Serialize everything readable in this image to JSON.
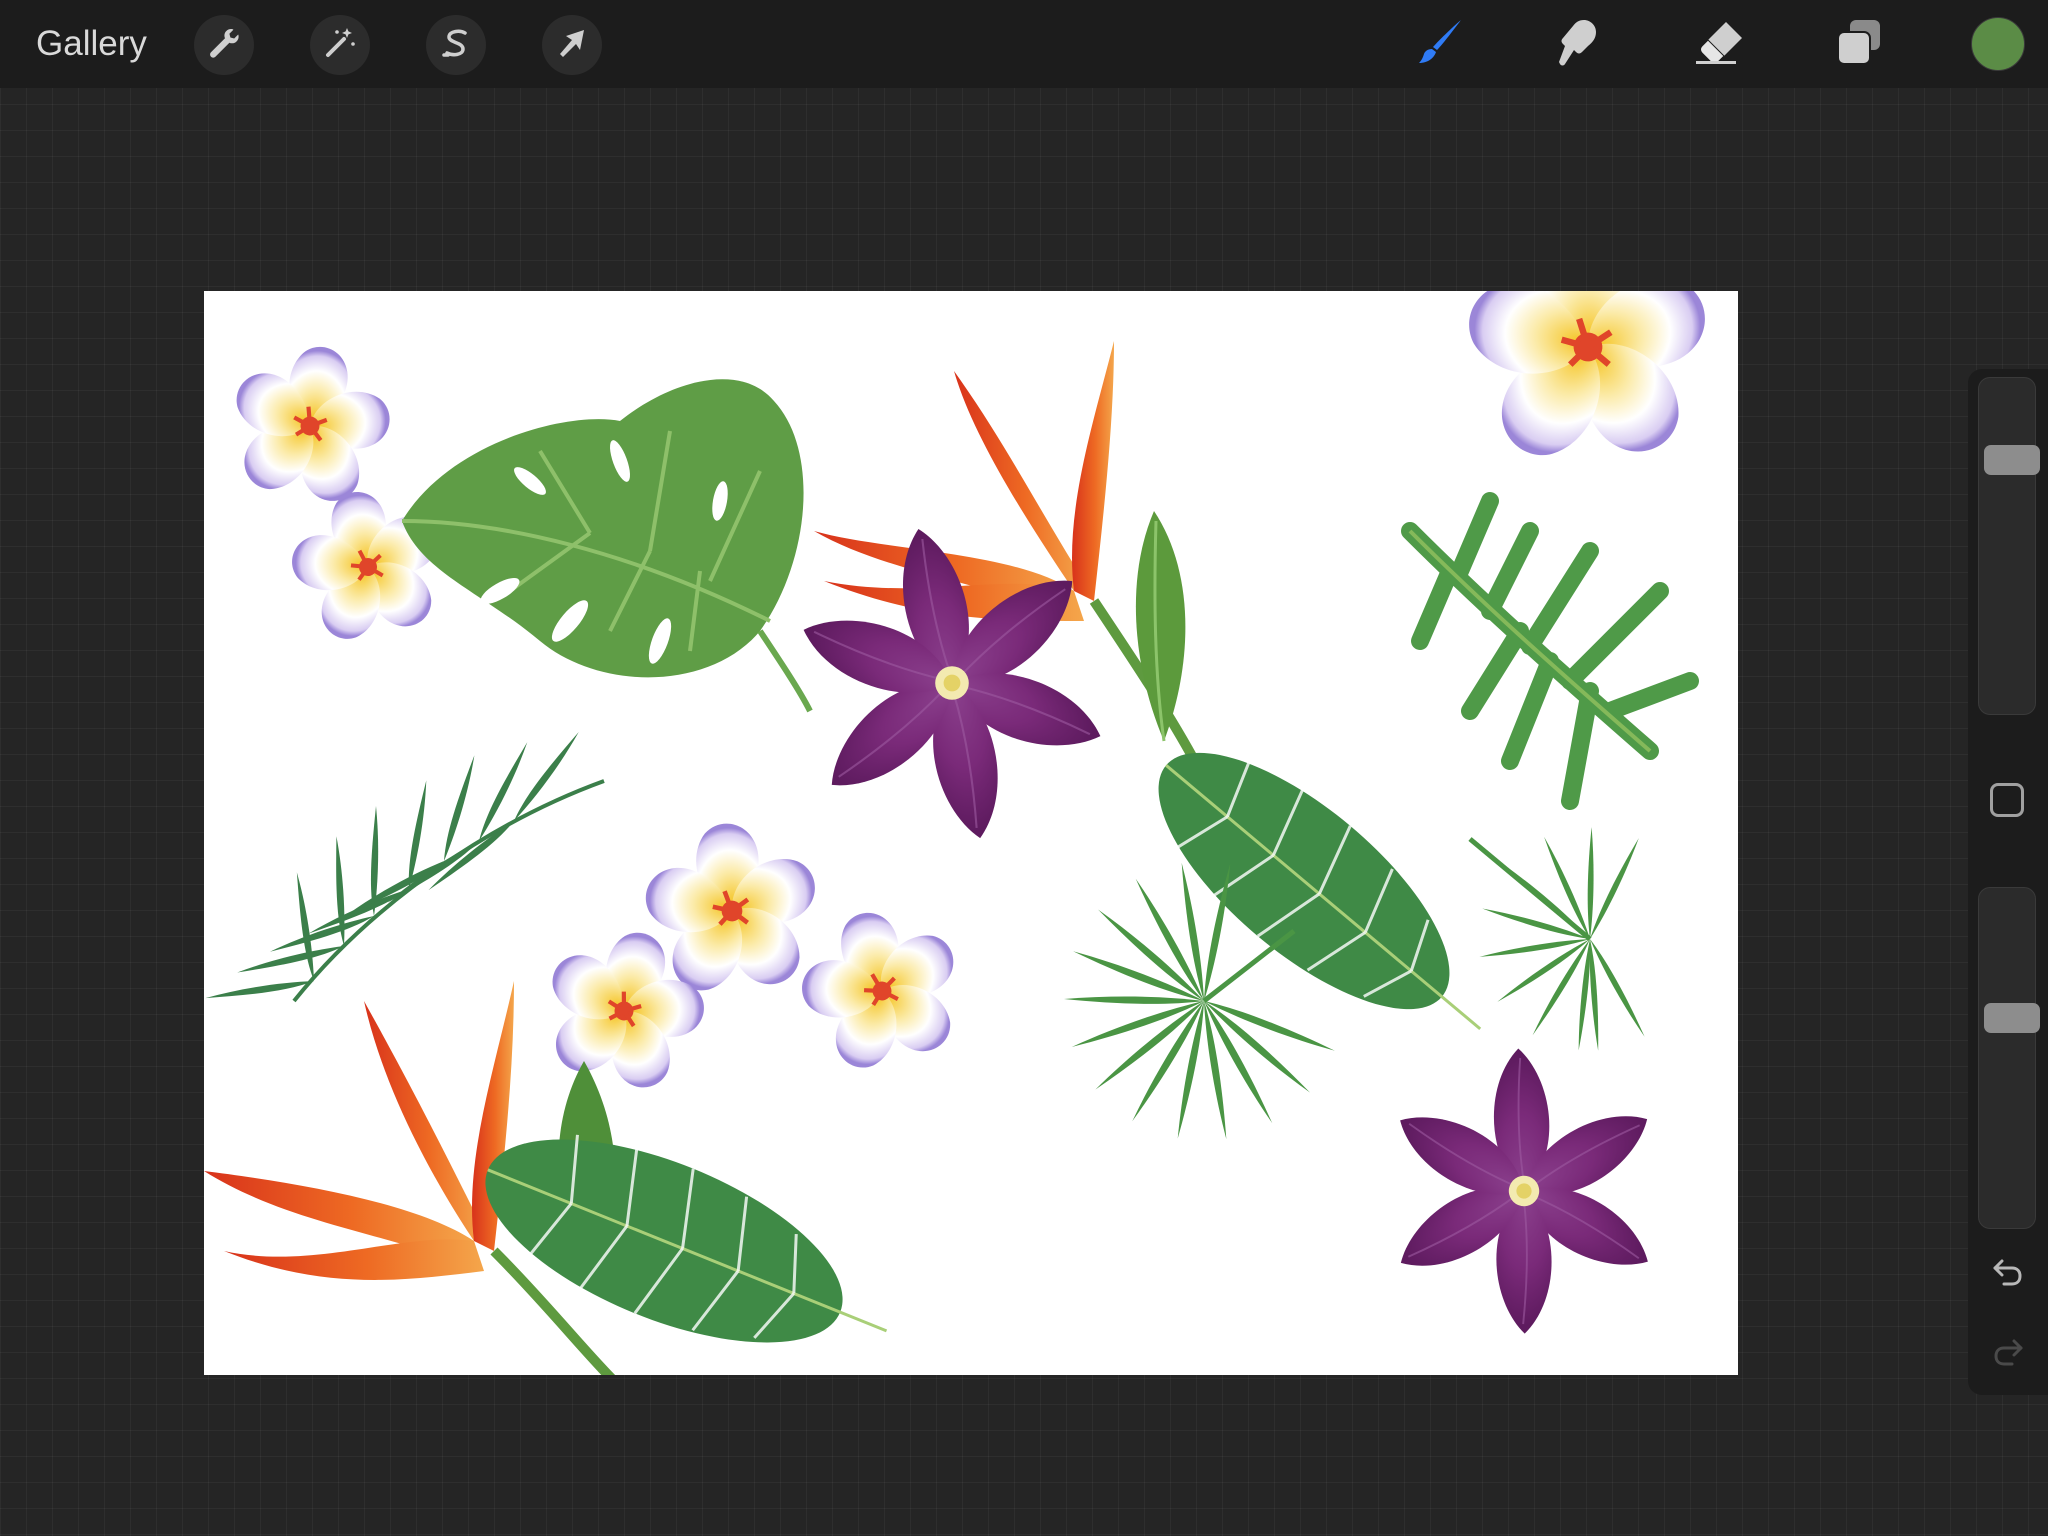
{
  "topbar": {
    "gallery_label": "Gallery",
    "left_tools": [
      {
        "name": "actions",
        "icon": "wrench-icon"
      },
      {
        "name": "adjustments",
        "icon": "magic-wand-icon"
      },
      {
        "name": "selection",
        "icon": "selection-s-icon"
      },
      {
        "name": "transform",
        "icon": "arrow-cursor-icon"
      }
    ],
    "right_tools": [
      {
        "name": "brush",
        "icon": "brush-icon",
        "active": true
      },
      {
        "name": "smudge",
        "icon": "smudge-finger-icon"
      },
      {
        "name": "eraser",
        "icon": "eraser-icon"
      },
      {
        "name": "layers",
        "icon": "layers-icon"
      }
    ],
    "current_color": "#5b8c46",
    "active_tool_color": "#2f7bf5"
  },
  "canvas": {
    "content": "tropical-botanical-illustration",
    "elements": [
      "plumeria",
      "monstera-leaf",
      "bird-of-paradise",
      "clematis",
      "palm-frond",
      "banana-leaf",
      "fan-palm",
      "philodendron-leaf"
    ]
  },
  "sidebar": {
    "brush_size_level": 0.22,
    "opacity_level": 0.37,
    "controls": [
      "brush-size-slider",
      "modify-button",
      "opacity-slider",
      "undo-icon",
      "redo-icon"
    ]
  }
}
